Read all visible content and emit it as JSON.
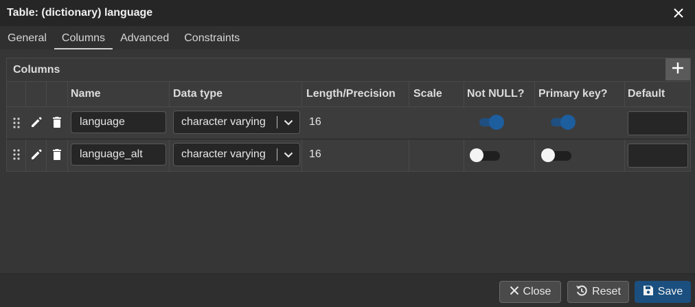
{
  "window": {
    "title": "Table: (dictionary) language"
  },
  "tabs": [
    {
      "label": "General"
    },
    {
      "label": "Columns"
    },
    {
      "label": "Advanced"
    },
    {
      "label": "Constraints"
    }
  ],
  "active_tab": "Columns",
  "columns_panel": {
    "title": "Columns",
    "headers": {
      "name": "Name",
      "data_type": "Data type",
      "length": "Length/Precision",
      "scale": "Scale",
      "not_null": "Not NULL?",
      "primary_key": "Primary key?",
      "default": "Default"
    },
    "rows": [
      {
        "name": "language",
        "data_type": "character varying",
        "length": "16",
        "scale": "",
        "not_null": true,
        "primary_key": true,
        "default": ""
      },
      {
        "name": "language_alt",
        "data_type": "character varying",
        "length": "16",
        "scale": "",
        "not_null": false,
        "primary_key": false,
        "default": ""
      }
    ]
  },
  "footer": {
    "close_label": "Close",
    "reset_label": "Reset",
    "save_label": "Save"
  },
  "colors": {
    "primary": "#1a4f7f",
    "toggle_on": "#1d5e9f",
    "background": "#363636"
  },
  "icons": [
    "close-icon",
    "plus-icon",
    "drag-handle-icon",
    "edit-icon",
    "delete-icon",
    "chevron-down-icon",
    "reset-icon",
    "save-icon"
  ]
}
